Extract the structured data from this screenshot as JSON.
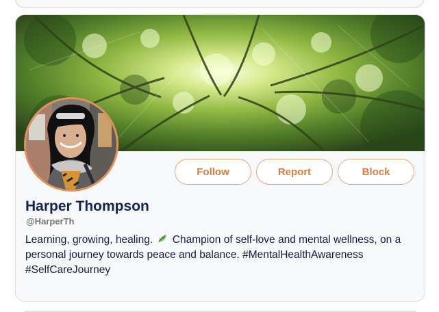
{
  "profile": {
    "name": "Harper Thompson",
    "handle": "@HarperTh",
    "bio_before_icon": "Learning, growing, healing.",
    "bio_icon": "leaf-icon",
    "bio_after_icon": "Champion of self-love and mental wellness, on a personal journey towards peace and balance. #MentalHealthAwareness #SelfCareJourney"
  },
  "actions": {
    "follow": "Follow",
    "report": "Report",
    "block": "Block"
  },
  "colors": {
    "accent_orange": "#e07b3e",
    "name_navy": "#13235a",
    "handle_gray": "#777777"
  }
}
